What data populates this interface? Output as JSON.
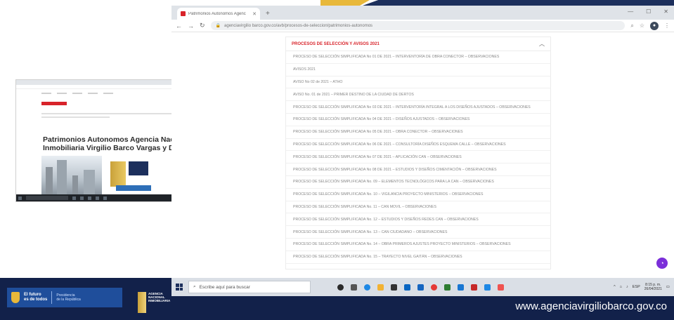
{
  "browser": {
    "tab_title": "Patrimonios Autonomos Agenc",
    "url": "agenciavirgilio barco.gov.co/avb/procesos-de-seleccion/patrimonios-autonomos",
    "new_tab_symbol": "+"
  },
  "accordion": {
    "heading": "PROCESOS DE SELECCIÓN Y AVISOS 2021",
    "items": [
      "PROCESO DE SELECCIÓN SIMPLIFICADA No 01 DE 2021 – INTERVENTORÍA DE OBRA CONECTOR – OBSERVACIONES",
      "AVISOS 2021",
      "AVISO No 02 de 2021 – ATHO",
      "AVISO No. 01 de 2021 – PRIMER DESTINO DE LA CIUDAD DE DERTOS",
      "PROCESO DE SELECCIÓN SIMPLIFICADA No 03 DE 2021 – INTERVENTORÍA INTEGRAL A LOS DISEÑOS AJUSTADOS – OBSERVACIONES",
      "PROCESO DE SELECCIÓN SIMPLIFICADA No 04 DE 2021 – DISEÑOS AJUSTADOS – OBSERVACIONES",
      "PROCESO DE SELECCIÓN SIMPLIFICADA No 05 DE 2021 – OBRA CONECTOR – OBSERVACIONES",
      "PROCESO DE SELECCIÓN SIMPLIFICADA No 06 DE 2021 – CONSULTORÍA DISEÑOS ESQUEMA CALLE – OBSERVACIONES",
      "PROCESO DE SELECCIÓN SIMPLIFICADA No 07 DE 2021 – APLICACIÓN CAN – OBSERVACIONES",
      "PROCESO DE SELECCIÓN SIMPLIFICADA No 08 DE 2021 – ESTUDIOS Y DISEÑOS CIMENTACIÓN – OBSERVACIONES",
      "PROCESO DE SELECCIÓN SIMPLIFICADA No. 09 – ELEMENTOS TECNOLÓGICOS PARA LA CAN – OBSERVACIONES",
      "PROCESO DE SELECCIÓN SIMPLIFICADA No. 10 – VIGILANCIA PROYECTO MINISTERIOS – OBSERVACIONES",
      "PROCESO DE SELECCIÓN SIMPLIFICADA No. 11 – CAN MOVIL – OBSERVACIONES",
      "PROCESO DE SELECCIÓN SIMPLIFICADA No. 12 – ESTUDIOS Y DISEÑOS REDES CAN – OBSERVACIONES",
      "PROCESO DE SELECCIÓN SIMPLIFICADA No. 13 – CAN CIUDADANO – OBSERVACIONES",
      "PROCESO DE SELECCIÓN SIMPLIFICADA No. 14 – OBRA PRIMEROS AJUSTES PROYECTO MINISTERIOS – OBSERVACIONES",
      "PROCESO DE SELECCIÓN SIMPLIFICADA No. 15 – TRAYECTO NIVEL GAITÁN – OBSERVACIONES"
    ]
  },
  "taskbar": {
    "search_placeholder": "Escribe aquí para buscar",
    "time": "8:15 p. m.",
    "date": "26/04/2021",
    "lang": "ESP"
  },
  "thumbnail": {
    "title": "Patrimonios Autonomos Agencia Nacional Inmobiliaria Virgilio Barco Vargas y Derivados"
  },
  "banner": {
    "gov_line1": "El futuro",
    "gov_line2": "es de todos",
    "gov_sub1": "Presidencia",
    "gov_sub2": "de la República",
    "agency_logo_text": "AGENCIA NACIONAL INMOBILIARIA",
    "website": "www.agenciavirgiliobarco.gov.co"
  },
  "colors": {
    "brand_red": "#d8232a",
    "navy": "#12214a",
    "arrow_blue": "#6b9bd1"
  }
}
